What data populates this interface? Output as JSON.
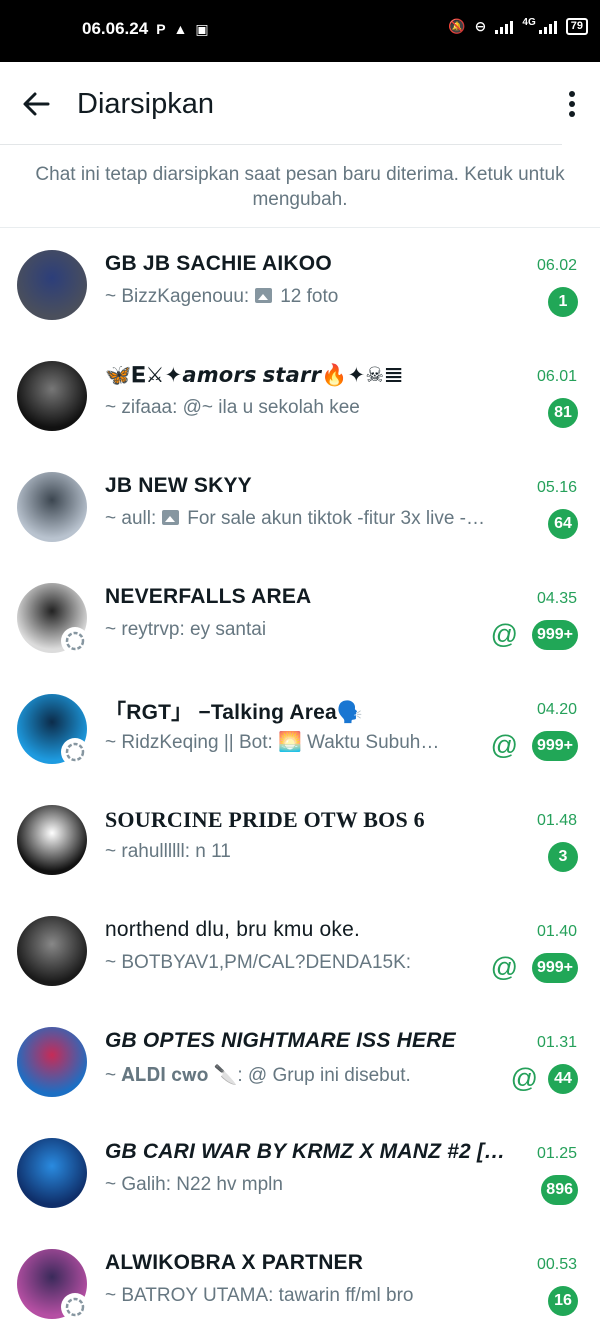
{
  "statusbar": {
    "time": "06.06.24",
    "icons_left": [
      "P",
      "notification-icon",
      "app-icon"
    ],
    "network": "4G",
    "battery": "79"
  },
  "appbar": {
    "title": "Diarsipkan"
  },
  "info_text": "Chat ini tetap diarsipkan saat pesan baru diterima. Ketuk untuk mengubah.",
  "chats": [
    {
      "name": "GB JB SACHIE AIKOO",
      "time": "06.02",
      "sender": "~ BizzKagenouu:",
      "message": "12 foto",
      "has_photo": true,
      "badge": "1",
      "mention": false,
      "avatar_color": "#4a4f5c",
      "avatar_accent": "#2c3e7a"
    },
    {
      "name": "🦋𝐄⚔✦𝙖𝙢𝙤𝙧𝙨 𝙨𝙩𝙖𝙧𝙧🔥✦☠𝌆",
      "time": "06.01",
      "sender": "~ zifaaa: @~",
      "message": "ila u sekolah kee",
      "has_photo": false,
      "badge": "81",
      "mention": false,
      "avatar_color": "#111111",
      "avatar_accent": "#777777"
    },
    {
      "name": "JB NEW SKYY",
      "time": "05.16",
      "sender": "~ aull:",
      "message": "For sale akun tiktok -fitur 3x live -…",
      "has_photo": true,
      "badge": "64",
      "mention": false,
      "avatar_color": "#b9c3cf",
      "avatar_accent": "#3c4650"
    },
    {
      "name": "NEVERFALLS AREA",
      "time": "04.35",
      "sender": "~ reytrvp:",
      "message": "ey santai",
      "has_photo": false,
      "badge": "999+",
      "mention": true,
      "avatar_color": "#dcdcdc",
      "avatar_accent": "#222222"
    },
    {
      "name": "「RGT」 −Talking Area🗣️",
      "time": "04.20",
      "sender": "~ RidzKeqing || Bot:",
      "message": "🌅 Waktu Subuh…",
      "has_photo": false,
      "badge": "999+",
      "mention": true,
      "avatar_color": "#1e9be0",
      "avatar_accent": "#0c2c4a"
    },
    {
      "name": "SOURCINE PRIDE OTW BOS 6",
      "time": "01.48",
      "sender": "~ rahullllll:",
      "message": "n 11",
      "has_photo": false,
      "badge": "3",
      "mention": false,
      "avatar_color": "#111111",
      "avatar_accent": "#ffffff"
    },
    {
      "name": "northend dlu, bru kmu oke.",
      "time": "01.40",
      "sender": "~ BOTBYAV1,PM/CAL?DENDA15K:",
      "message": "",
      "has_photo": false,
      "badge": "999+",
      "mention": true,
      "avatar_color": "#1a1a1a",
      "avatar_accent": "#888888"
    },
    {
      "name": "GB OPTES NIGHTMARE ISS HERE",
      "time": "01.31",
      "sender": "~ 𝐀𝐋𝐃𝐈 𝐜𝐰𝐨 🔪:",
      "message": "@ Grup ini disebut.",
      "has_photo": false,
      "badge": "44",
      "mention": true,
      "avatar_color": "#1c6fc4",
      "avatar_accent": "#c62b57"
    },
    {
      "name": "GB CARI WAR BY KRMZ X MANZ #2 […",
      "time": "01.25",
      "sender": "~ Galih:",
      "message": "N22 hv mpln",
      "has_photo": false,
      "badge": "896",
      "mention": false,
      "avatar_color": "#0f2f6a",
      "avatar_accent": "#2a8be0"
    },
    {
      "name": "ALWIKOBRA X PARTNER",
      "time": "00.53",
      "sender": "~ BATROY UTAMA:",
      "message": "tawarin ff/ml bro",
      "has_photo": false,
      "badge": "16",
      "mention": false,
      "avatar_color": "#b54fa3",
      "avatar_accent": "#3a2a5a"
    }
  ]
}
